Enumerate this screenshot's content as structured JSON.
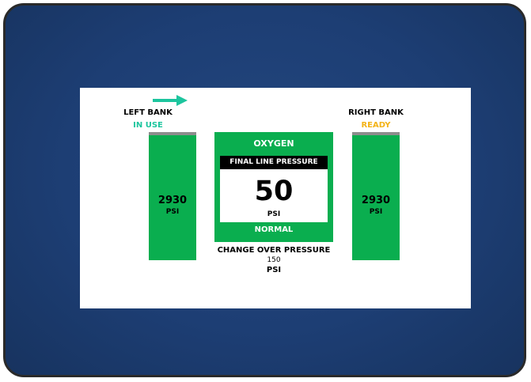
{
  "gas": "OXYGEN",
  "colors": {
    "frame": "#1f3f75",
    "panel_green": "#0aae4f",
    "in_use": "#1dc59e",
    "ready": "#f3b317",
    "bar_cap": "#8d8d8d"
  },
  "left_bank": {
    "title": "LEFT BANK",
    "status": "IN USE",
    "value": "2930",
    "unit": "PSI",
    "active_arrow_icon": "arrow-right-icon"
  },
  "right_bank": {
    "title": "RIGHT BANK",
    "status": "READY",
    "value": "2930",
    "unit": "PSI"
  },
  "final_line": {
    "title": "FINAL LINE PRESSURE",
    "value": "50",
    "unit": "PSI",
    "status": "NORMAL"
  },
  "change_over": {
    "title": "CHANGE OVER PRESSURE",
    "value": "150",
    "unit": "PSI"
  }
}
